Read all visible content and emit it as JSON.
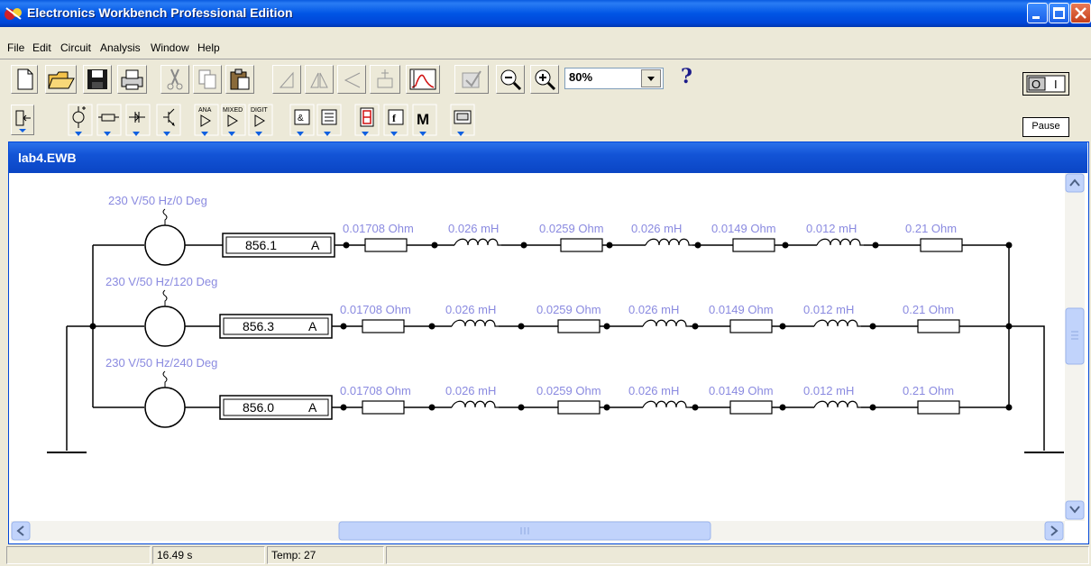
{
  "window": {
    "title": "Electronics Workbench Professional Edition"
  },
  "menu": [
    {
      "label": "File"
    },
    {
      "label": "Edit"
    },
    {
      "label": "Circuit"
    },
    {
      "label": "Analysis"
    },
    {
      "label": "Window"
    },
    {
      "label": "Help"
    }
  ],
  "toolbar": {
    "zoom": "80%",
    "help": "?",
    "pause": "Pause",
    "power": "O I",
    "parts_labels": [
      "ANA",
      "MIXED",
      "DIGIT"
    ],
    "m_label": "M"
  },
  "document": {
    "title": "lab4.EWB"
  },
  "circuit": {
    "sources": [
      "230 V/50 Hz/0 Deg",
      "230 V/50 Hz/120 Deg",
      "230 V/50 Hz/240 Deg"
    ],
    "ammeters": [
      {
        "value": "856.1",
        "unit": "A"
      },
      {
        "value": "856.3",
        "unit": "A"
      },
      {
        "value": "856.0",
        "unit": "A"
      }
    ],
    "components": [
      "0.01708  Ohm",
      "0.026 mH",
      "0.0259  Ohm",
      "0.026 mH",
      "0.0149  Ohm",
      "0.012 mH",
      "0.21  Ohm"
    ]
  },
  "status": {
    "time": "16.49 s",
    "temp": "Temp:  27"
  },
  "colors": {
    "title_blue": "#0055e5",
    "label_blue": "#8a8ae0",
    "face": "#ece9d8"
  }
}
